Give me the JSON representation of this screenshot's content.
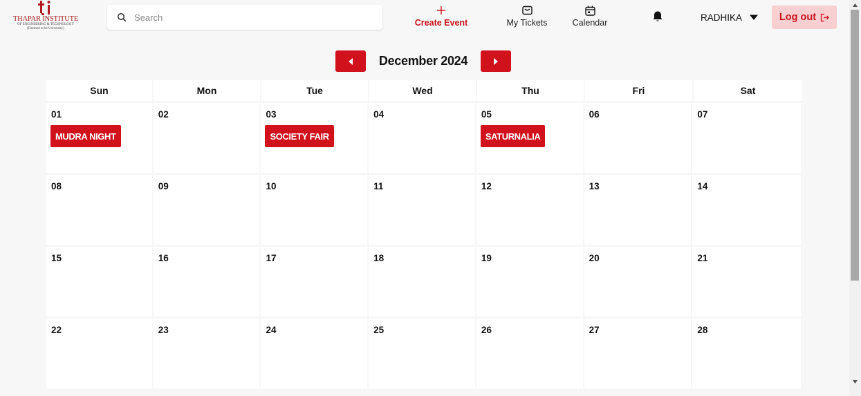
{
  "brand": {
    "title": "THAPAR INSTITUTE",
    "subtitle": "OF ENGINEERING & TECHNOLOGY",
    "subtitle2": "(Deemed to be University)",
    "mark": "ti",
    "color": "#a61b1b"
  },
  "search": {
    "placeholder": "Search",
    "value": ""
  },
  "nav": {
    "create_event": "Create Event",
    "my_tickets": "My Tickets",
    "calendar": "Calendar"
  },
  "user": {
    "name": "RADHIKA"
  },
  "logout": {
    "label": "Log out"
  },
  "month": {
    "label": "December 2024"
  },
  "weekdays": [
    "Sun",
    "Mon",
    "Tue",
    "Wed",
    "Thu",
    "Fri",
    "Sat"
  ],
  "weeks": [
    [
      {
        "day": "01",
        "event": "MUDRA NIGHT"
      },
      {
        "day": "02",
        "event": ""
      },
      {
        "day": "03",
        "event": "SOCIETY FAIR"
      },
      {
        "day": "04",
        "event": ""
      },
      {
        "day": "05",
        "event": "SATURNALIA"
      },
      {
        "day": "06",
        "event": ""
      },
      {
        "day": "07",
        "event": ""
      }
    ],
    [
      {
        "day": "08",
        "event": ""
      },
      {
        "day": "09",
        "event": ""
      },
      {
        "day": "10",
        "event": ""
      },
      {
        "day": "11",
        "event": ""
      },
      {
        "day": "12",
        "event": ""
      },
      {
        "day": "13",
        "event": ""
      },
      {
        "day": "14",
        "event": ""
      }
    ],
    [
      {
        "day": "15",
        "event": ""
      },
      {
        "day": "16",
        "event": ""
      },
      {
        "day": "17",
        "event": ""
      },
      {
        "day": "18",
        "event": ""
      },
      {
        "day": "19",
        "event": ""
      },
      {
        "day": "20",
        "event": ""
      },
      {
        "day": "21",
        "event": ""
      }
    ],
    [
      {
        "day": "22",
        "event": ""
      },
      {
        "day": "23",
        "event": ""
      },
      {
        "day": "24",
        "event": ""
      },
      {
        "day": "25",
        "event": ""
      },
      {
        "day": "26",
        "event": ""
      },
      {
        "day": "27",
        "event": ""
      },
      {
        "day": "28",
        "event": ""
      }
    ]
  ],
  "icons": {
    "search": "search-icon",
    "create": "plus-icon",
    "tickets": "ticket-box-icon",
    "calendar": "calendar-icon",
    "bell": "bell-icon",
    "caret": "caret-down-icon",
    "logout": "logout-icon",
    "prev": "caret-left-icon",
    "next": "caret-right-icon"
  },
  "colors": {
    "accent": "#d1111b",
    "logout_bg": "#f9cfd1",
    "background": "#f7f7f7"
  }
}
